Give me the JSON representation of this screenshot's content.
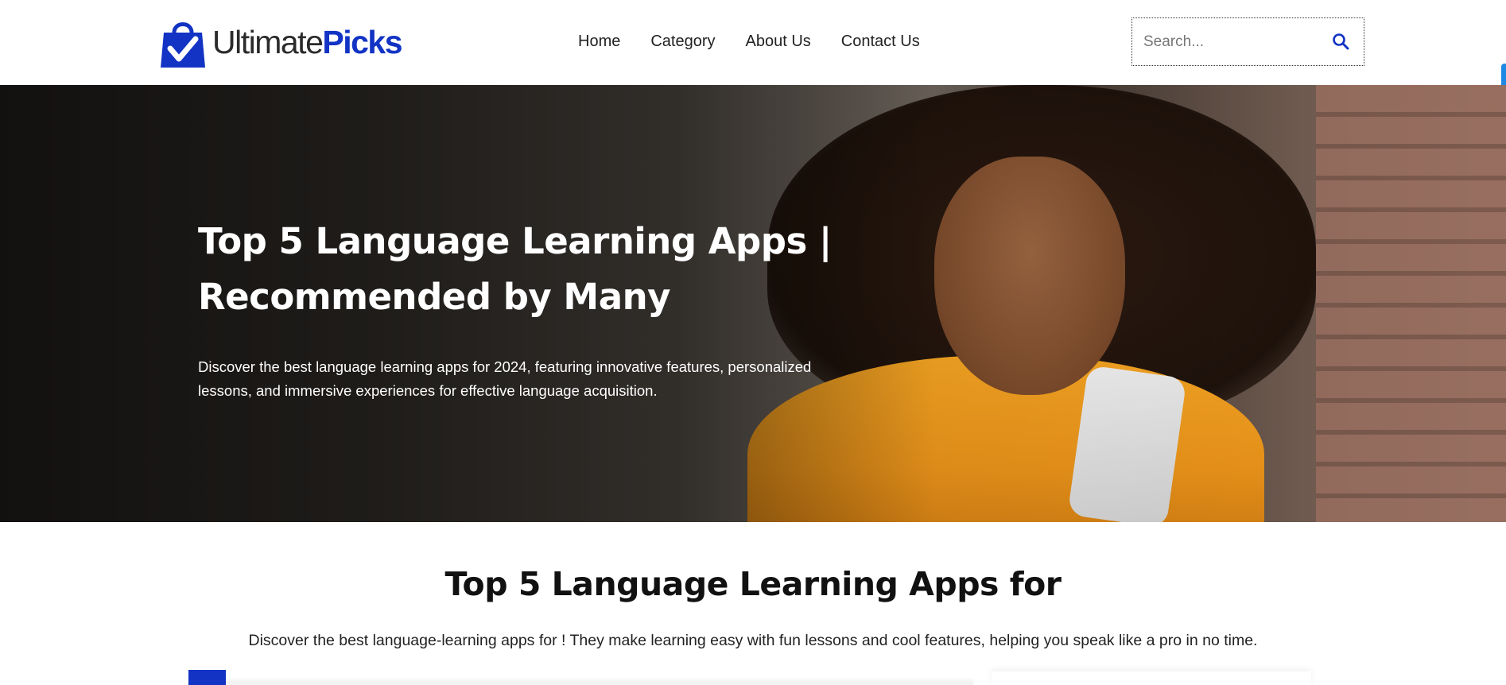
{
  "header": {
    "logo": {
      "word1": "Ultimate",
      "word2": "Picks",
      "brand_color": "#1233c4"
    },
    "nav": [
      {
        "label": "Home"
      },
      {
        "label": "Category"
      },
      {
        "label": "About Us"
      },
      {
        "label": "Contact Us"
      }
    ],
    "search": {
      "placeholder": "Search...",
      "icon": "search-icon"
    }
  },
  "hero": {
    "title": "Top 5 Language Learning Apps | Recommended by Many",
    "description": "Discover the best language learning apps for 2024, featuring innovative features, personalized lessons, and immersive experiences for effective language acquisition."
  },
  "main": {
    "section_title": "Top 5 Language Learning Apps for",
    "section_description": "Discover the best language-learning apps for ! They make learning easy with fun lessons and cool features, helping you speak like a pro in no time."
  },
  "colors": {
    "accent": "#1233c4",
    "edge_tab": "#1e88e5"
  }
}
